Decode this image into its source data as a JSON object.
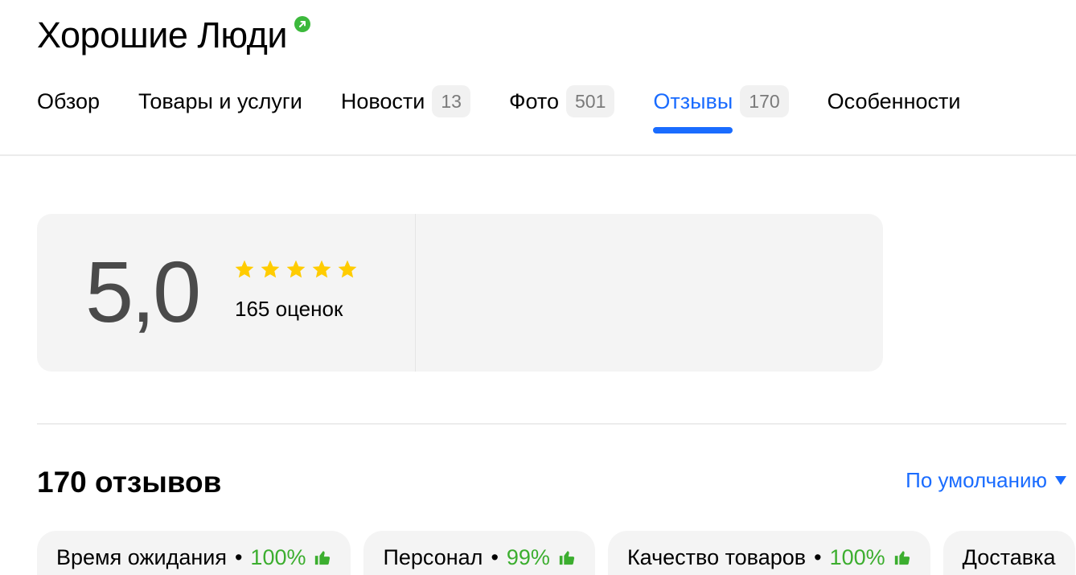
{
  "header": {
    "title": "Хорошие Люди",
    "verified_icon": "verified-badge-icon"
  },
  "tabs": [
    {
      "label": "Обзор",
      "count": null,
      "active": false
    },
    {
      "label": "Товары и услуги",
      "count": null,
      "active": false
    },
    {
      "label": "Новости",
      "count": "13",
      "active": false
    },
    {
      "label": "Фото",
      "count": "501",
      "active": false
    },
    {
      "label": "Отзывы",
      "count": "170",
      "active": true
    },
    {
      "label": "Особенности",
      "count": null,
      "active": false
    }
  ],
  "rating": {
    "score": "5,0",
    "stars": 5,
    "count_label": "165 оценок"
  },
  "reviews": {
    "title": "170 отзывов",
    "sort_label": "По умолчанию"
  },
  "aspects": [
    {
      "name": "Время ожидания",
      "separator": "•",
      "percent": "100%"
    },
    {
      "name": "Персонал",
      "separator": "•",
      "percent": "99%"
    },
    {
      "name": "Качество товаров",
      "separator": "•",
      "percent": "100%"
    },
    {
      "name": "Доставка",
      "separator": "",
      "percent": ""
    }
  ],
  "colors": {
    "accent": "#1a6cff",
    "star": "#ffcc00",
    "positive": "#3cae2f",
    "card_bg": "#f4f4f4"
  }
}
